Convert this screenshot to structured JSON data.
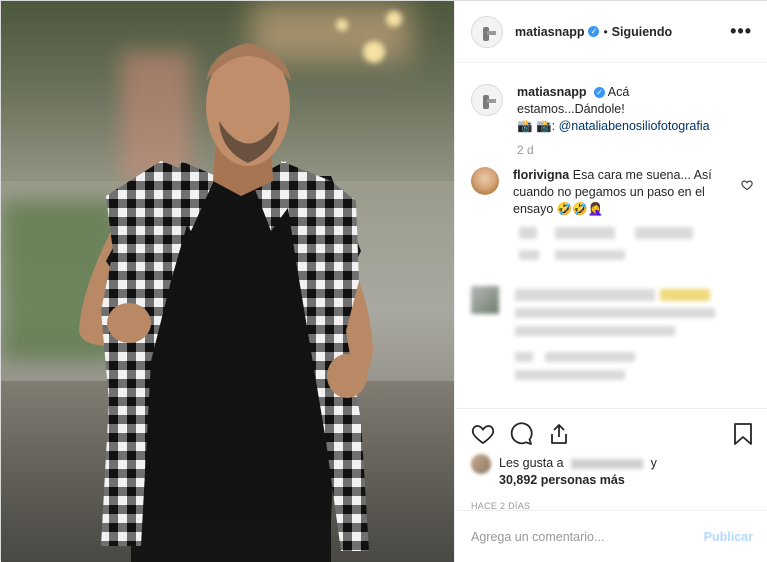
{
  "header": {
    "username": "matiasnapp",
    "separator": "•",
    "follow_status": "Siguiendo",
    "more_label": "•••"
  },
  "caption": {
    "username": "matiasnapp",
    "text": "Acá estamos...Dándole!",
    "credit_prefix": "📸 📸:",
    "credit_handle": "@nataliabenosiliofotografia",
    "time": "2 d"
  },
  "comment": {
    "username": "florivigna",
    "text": "Esa cara me suena... Así cuando no pegamos un paso en el ensayo 🤣🤣🤦‍♀️"
  },
  "likes": {
    "prefix": "Les gusta a",
    "conj": "y",
    "count_text": "30,892 personas más"
  },
  "posted_ago": "HACE 2 DÍAS",
  "add_comment": {
    "placeholder": "Agrega un comentario...",
    "publish_label": "Publicar"
  },
  "colors": {
    "verified": "#3897f0",
    "link": "#003569",
    "publish": "#b3dbff"
  },
  "icons": [
    "heart-icon",
    "comment-icon",
    "share-icon",
    "bookmark-icon",
    "more-icon",
    "verified-icon"
  ]
}
